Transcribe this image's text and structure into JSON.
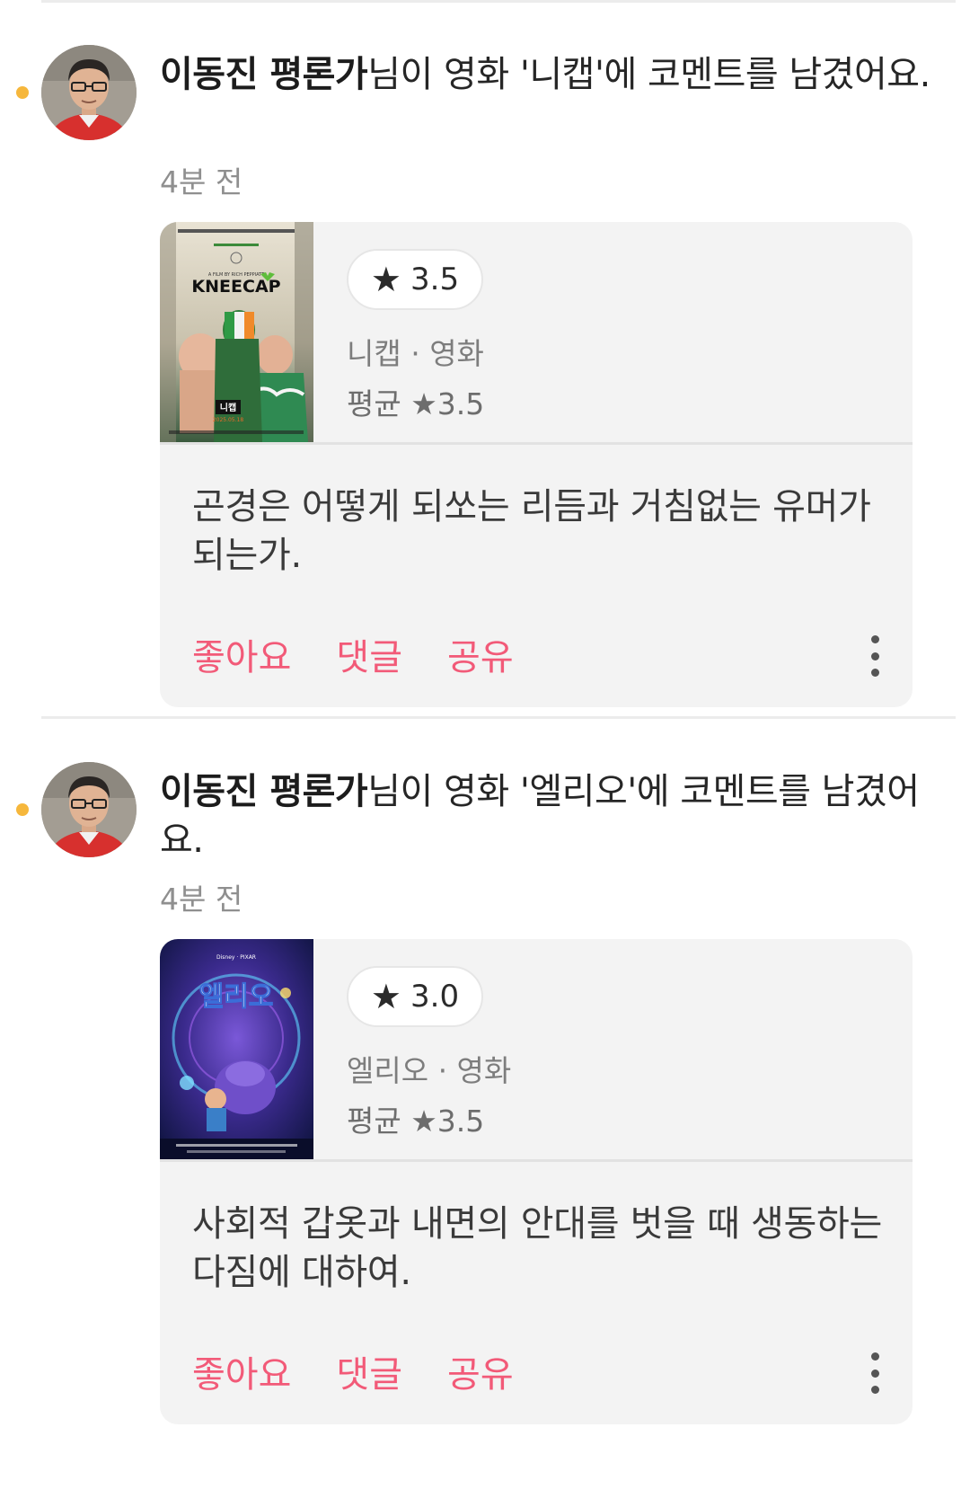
{
  "feed": [
    {
      "user_name": "이동진 평론가",
      "headline_rest": "님이 영화 '니캡'에 코멘트를 남겼어요.",
      "time": "4분 전",
      "rating_star": "★",
      "rating": "3.5",
      "movie_meta": "니캡 · 영화",
      "avg_rating": "평균 ★3.5",
      "comment": "곤경은 어떻게 되쏘는 리듬과 거침없는 유머가 되는가.",
      "actions": {
        "like": "좋아요",
        "reply": "댓글",
        "share": "공유"
      },
      "poster": {
        "title_text": "KNEECAP",
        "korean_title": "니캡",
        "date_text": "2025.05.18",
        "tagline": "A FILM BY RICH PEPPIATT"
      }
    },
    {
      "user_name": "이동진 평론가",
      "headline_rest": "님이 영화 '엘리오'에 코멘트를 남겼어요.",
      "time": "4분 전",
      "rating_star": "★",
      "rating": "3.0",
      "movie_meta": "엘리오 · 영화",
      "avg_rating": "평균 ★3.5",
      "comment": "사회적 갑옷과 내면의 안대를 벗을 때 생동하는 다짐에 대하여.",
      "actions": {
        "like": "좋아요",
        "reply": "댓글",
        "share": "공유"
      },
      "poster": {
        "title_text": "엘리오",
        "studio_text": "Disney · PIXAR"
      }
    }
  ],
  "colors": {
    "accent": "#f25a78",
    "unread_dot": "#f6b73c",
    "card_bg": "#f3f3f3"
  }
}
